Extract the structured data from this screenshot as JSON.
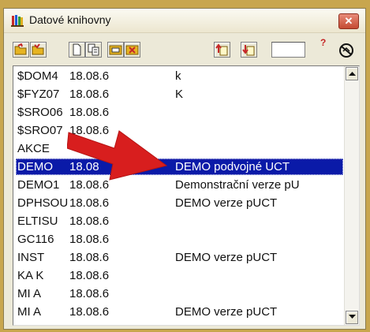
{
  "window": {
    "title": "Datové knihovny",
    "close_label": "✕"
  },
  "toolbar": {
    "icons": [
      "folder-open-icon",
      "folder-add-icon",
      "new-document-icon",
      "copy-document-icon",
      "edit-folder-icon",
      "delete-folder-icon",
      "move-up-icon",
      "move-down-icon",
      "help-icon",
      "settings-disabled-icon"
    ],
    "input_value": ""
  },
  "list": {
    "rows": [
      {
        "code": "$DOM4",
        "version": "18.08.6",
        "description": "k"
      },
      {
        "code": "$FYZ07",
        "version": "18.08.6",
        "description": "K"
      },
      {
        "code": "$SRO06",
        "version": "18.08.6",
        "description": ""
      },
      {
        "code": "$SRO07",
        "version": "18.08.6",
        "description": ""
      },
      {
        "code": "AKCE",
        "version": "",
        "description": ""
      },
      {
        "code": "DEMO",
        "version": "18.08",
        "description": "DEMO podvojné UCT",
        "selected": true
      },
      {
        "code": "DEMO1",
        "version": "18.08.6",
        "description": "Demonstrační verze pU"
      },
      {
        "code": "DPHSOU",
        "version": "18.08.6",
        "description": "DEMO verze pUCT"
      },
      {
        "code": "ELTISU",
        "version": "18.08.6",
        "description": ""
      },
      {
        "code": "GC116",
        "version": "18.08.6",
        "description": ""
      },
      {
        "code": "INST",
        "version": "18.08.6",
        "description": "DEMO verze pUCT"
      },
      {
        "code": "KA K",
        "version": "18.08.6",
        "description": ""
      },
      {
        "code": "MI A",
        "version": "18.08.6",
        "description": ""
      },
      {
        "code": "MI A",
        "version": "18.08.6",
        "description": "DEMO verze pUCT"
      }
    ]
  },
  "colors": {
    "selection": "#0a1aa8",
    "annotation_arrow": "#d81e1e"
  }
}
